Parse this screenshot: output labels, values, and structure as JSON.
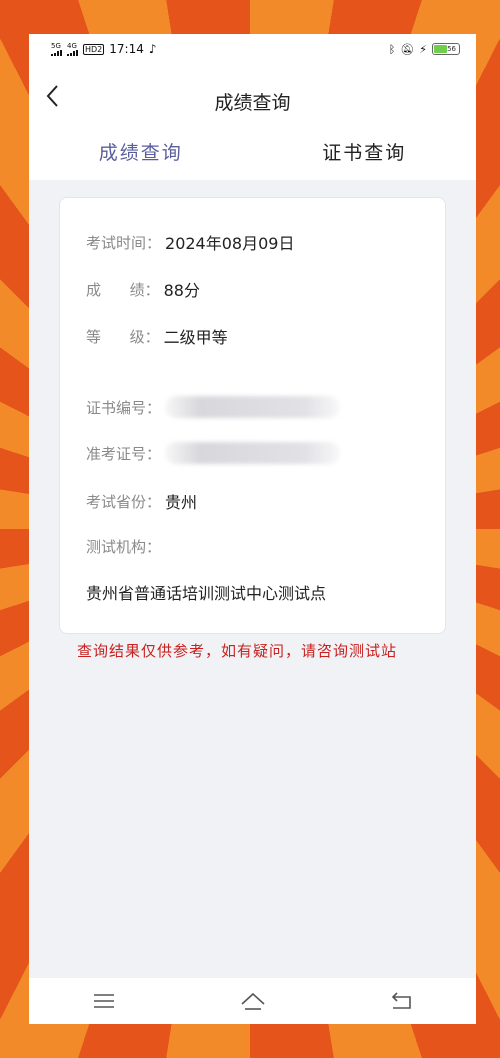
{
  "status_bar": {
    "network1": "5G",
    "network2": "4G",
    "hd": "HD2",
    "time": "17:14",
    "battery": "56"
  },
  "header": {
    "title": "成绩查询"
  },
  "tabs": [
    {
      "label": "成绩查询",
      "active": true
    },
    {
      "label": "证书查询",
      "active": false
    }
  ],
  "result": {
    "exam_time_label": "考试时间：",
    "exam_time_value": "2024年08月09日",
    "score_label": "成      绩：",
    "score_value": "88分",
    "level_label": "等      级：",
    "level_value": "二级甲等",
    "cert_no_label": "证书编号：",
    "ticket_no_label": "准考证号：",
    "province_label": "考试省份：",
    "province_value": "贵州",
    "org_label": "测试机构：",
    "org_value": "贵州省普通话培训测试中心测试点"
  },
  "note": "查询结果仅供参考，如有疑问，请咨询测试站",
  "colors": {
    "accent": "#5b5e9e",
    "warning": "#c8211f",
    "background_orange": "#e8651f"
  }
}
